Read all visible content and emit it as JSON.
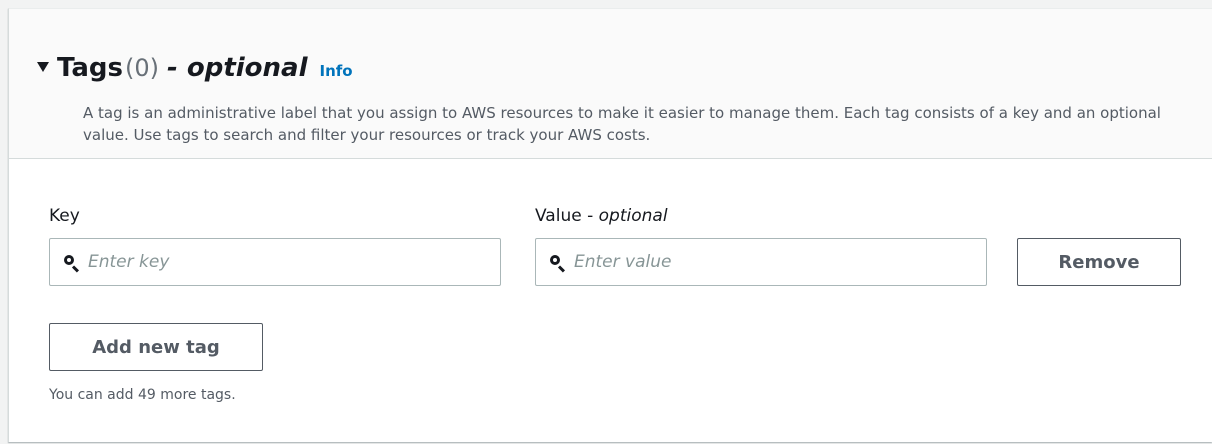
{
  "tags_section": {
    "title": "Tags",
    "count": "(0)",
    "optional_suffix": "- optional",
    "info_link": "Info",
    "description": "A tag is an administrative label that you assign to AWS resources to make it easier to manage them. Each tag consists of a key and an optional value. Use tags to search and filter your resources or track your AWS costs."
  },
  "tag_row": {
    "key_label": "Key",
    "value_label_main": "Value - ",
    "value_label_optional": "optional",
    "key_placeholder": "Enter key",
    "value_placeholder": "Enter value",
    "remove_button": "Remove"
  },
  "add_tag_button": "Add new tag",
  "limit_text": "You can add 49 more tags.",
  "icons": {
    "expand": "caret-down-icon",
    "search": "search-icon"
  },
  "colors": {
    "link": "#0073bb",
    "text": "#16191f",
    "muted": "#545b64",
    "placeholder": "#879596",
    "border": "#aab7b8"
  }
}
